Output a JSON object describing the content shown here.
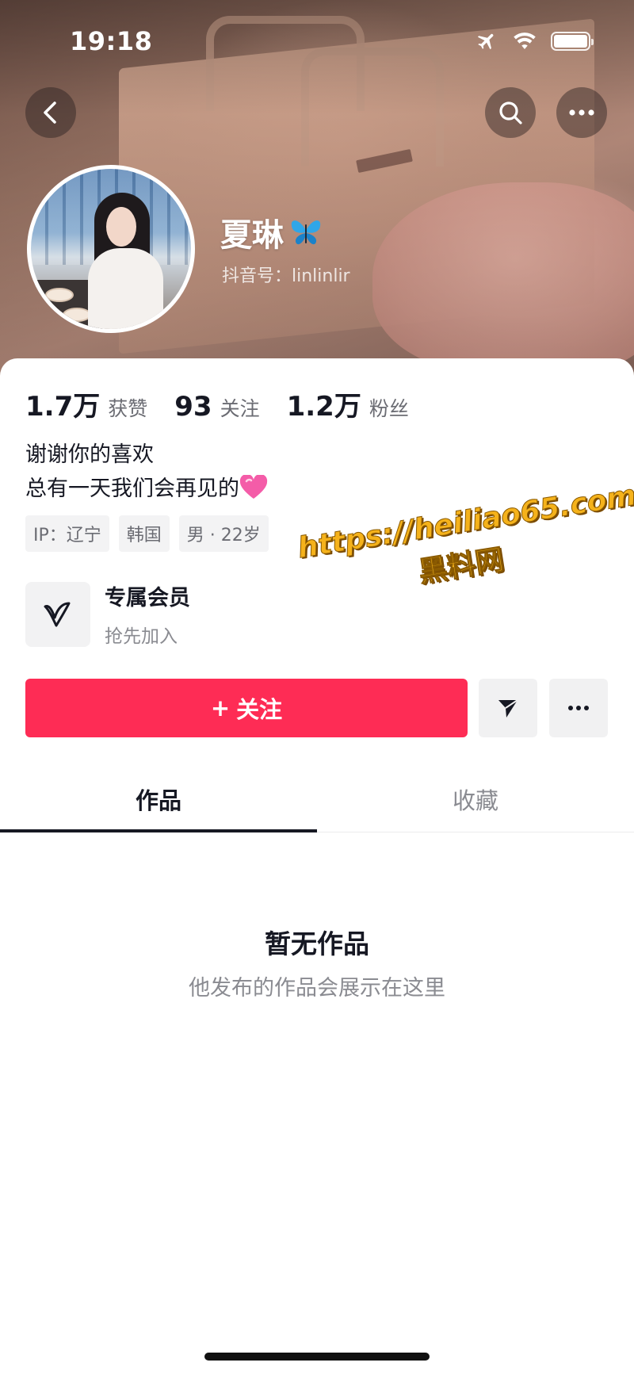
{
  "status_bar": {
    "time": "19:18"
  },
  "profile": {
    "nickname": "夏琳",
    "douyin_id": "抖音号：linlinlir"
  },
  "stats": [
    {
      "value": "1.7万",
      "label": "获赞"
    },
    {
      "value": "93",
      "label": "关注"
    },
    {
      "value": "1.2万",
      "label": "粉丝"
    }
  ],
  "bio": {
    "line1": "谢谢你的喜欢",
    "line2": "总有一天我们会再见的"
  },
  "tags": [
    "IP：辽宁",
    "韩国",
    "男 · 22岁"
  ],
  "member": {
    "title": "专属会员",
    "subtitle": "抢先加入"
  },
  "actions": {
    "follow_label": "关注",
    "follow_plus": "+"
  },
  "tabs": [
    {
      "label": "作品",
      "active": true
    },
    {
      "label": "收藏",
      "active": false
    }
  ],
  "empty": {
    "title": "暂无作品",
    "subtitle": "他发布的作品会展示在这里"
  },
  "watermark": {
    "line1": "https://heiliao65.com",
    "line2": "黑料网"
  },
  "colors": {
    "accent": "#fe2c55",
    "text": "#161823",
    "muted": "#8a8b91"
  }
}
